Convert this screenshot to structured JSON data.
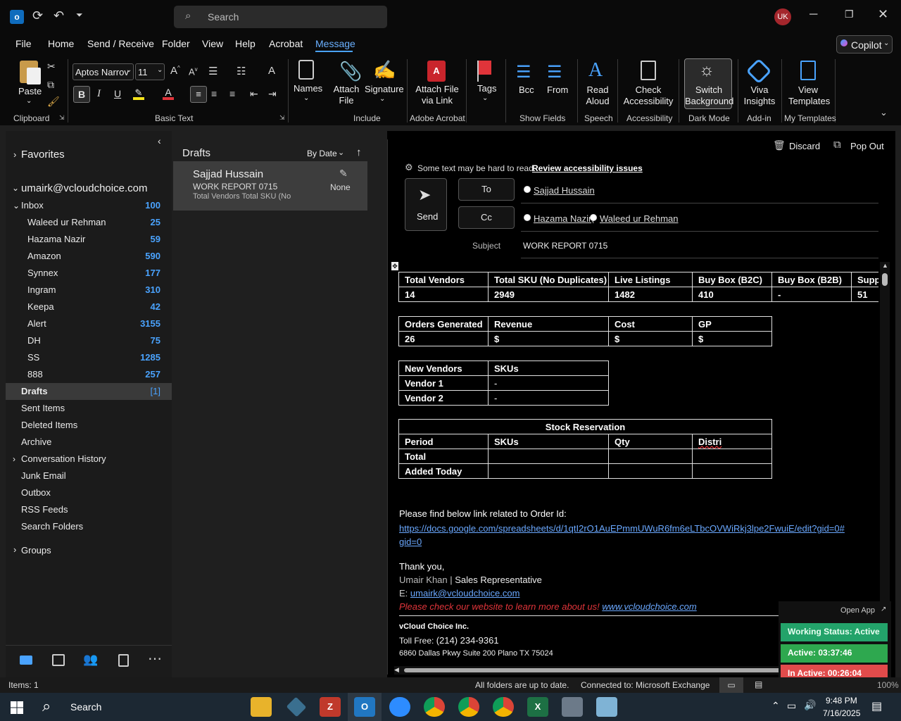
{
  "titlebar": {
    "search_placeholder": "Search",
    "avatar_initials": "UK"
  },
  "menu": [
    "File",
    "Home",
    "Send / Receive",
    "Folder",
    "View",
    "Help",
    "Acrobat",
    "Message"
  ],
  "active_menu": "Message",
  "copilot_label": "Copilot",
  "ribbon": {
    "paste": "Paste",
    "font_name": "Aptos Narrov",
    "font_size": "11",
    "names": "Names",
    "attach_file": [
      "Attach",
      "File"
    ],
    "signature": "Signature",
    "attach_via_link": [
      "Attach File",
      "via Link"
    ],
    "tags": "Tags",
    "bcc": "Bcc",
    "from": "From",
    "read_aloud": [
      "Read",
      "Aloud"
    ],
    "check_accessibility": [
      "Check",
      "Accessibility"
    ],
    "switch_background": [
      "Switch",
      "Background"
    ],
    "viva_insights": [
      "Viva",
      "Insights"
    ],
    "view_templates": [
      "View",
      "Templates"
    ],
    "groups": [
      "Clipboard",
      "Basic Text",
      "Include",
      "Adobe Acrobat",
      "Show Fields",
      "Speech",
      "Accessibility",
      "Dark Mode",
      "Add-in",
      "My Templates"
    ]
  },
  "nav": {
    "favorites": "Favorites",
    "account": "umairk@vcloudchoice.com",
    "folders": [
      {
        "name": "Inbox",
        "count": "100"
      },
      {
        "name": "Waleed ur Rehman",
        "count": "25"
      },
      {
        "name": "Hazama Nazir",
        "count": "59"
      },
      {
        "name": "Amazon",
        "count": "590"
      },
      {
        "name": "Synnex",
        "count": "177"
      },
      {
        "name": "Ingram",
        "count": "310"
      },
      {
        "name": "Keepa",
        "count": "42"
      },
      {
        "name": "Alert",
        "count": "3155"
      },
      {
        "name": "DH",
        "count": "75"
      },
      {
        "name": "SS",
        "count": "1285"
      },
      {
        "name": "888",
        "count": "257"
      },
      {
        "name": "Drafts",
        "count": "[1]"
      },
      {
        "name": "Sent Items",
        "count": ""
      },
      {
        "name": "Deleted Items",
        "count": ""
      },
      {
        "name": "Archive",
        "count": ""
      },
      {
        "name": "Conversation History",
        "count": ""
      },
      {
        "name": "Junk Email",
        "count": ""
      },
      {
        "name": "Outbox",
        "count": ""
      },
      {
        "name": "RSS Feeds",
        "count": ""
      },
      {
        "name": "Search Folders",
        "count": ""
      }
    ],
    "groups": "Groups"
  },
  "msglist": {
    "title": "Drafts",
    "sort": "By Date",
    "item": {
      "sender": "Sajjad Hussain",
      "subject": "WORK REPORT 0715",
      "preview": "Total Vendors  Total SKU (No",
      "tag": "None"
    }
  },
  "compose": {
    "discard": "Discard",
    "popout": "Pop Out",
    "accessibility_note": "Some text may be hard to read.",
    "accessibility_link": "Review accessibility issues",
    "send": "Send",
    "to_btn": "To",
    "cc_btn": "Cc",
    "to": [
      "Sajjad Hussain"
    ],
    "cc": [
      "Hazama Nazir;",
      "Waleed ur Rehman"
    ],
    "subject_label": "Subject",
    "subject": "WORK REPORT 0715"
  },
  "body": {
    "t1_head": [
      "Total Vendors",
      "Total SKU (No Duplicates)",
      "Live Listings",
      "Buy Box (B2C)",
      "Buy Box (B2B)",
      "Supp"
    ],
    "t1_row": [
      "14",
      "2949",
      "1482",
      "410",
      "-",
      "51"
    ],
    "t2_head": [
      "Orders Generated",
      "Revenue",
      "Cost",
      "GP"
    ],
    "t2_row": [
      "26",
      "$",
      "$",
      "$"
    ],
    "t3_head": [
      "New Vendors",
      "SKUs"
    ],
    "t3_rows": [
      [
        "Vendor 1",
        "-"
      ],
      [
        "Vendor 2",
        "-"
      ]
    ],
    "t4_title": "Stock Reservation",
    "t4_head": [
      "Period",
      "SKUs",
      "Qty",
      "Distri"
    ],
    "t4_rows": [
      "Total",
      "Added Today"
    ],
    "intro": "Please find below link related to Order Id:",
    "link": "https://docs.google.com/spreadsheets/d/1qtI2rO1AuEPmmUWuR6fm6eLTbcOVWiRkj3lpe2FwuiE/edit?gid=0#gid=0",
    "thanks": "Thank you,",
    "sig_name": "Umair Khan",
    "sig_title": "Sales Representative",
    "sig_email_label": "E:",
    "sig_email": "umairk@vcloudchoice.com",
    "sig_promo": "Please check our website to learn more about us!",
    "sig_site": "www.vcloudchoice.com",
    "company": "vCloud Choice Inc.",
    "tollfree_label": "Toll Free:",
    "tollfree": "(214) 234-9361",
    "address": "6860 Dallas Pkwy Suite 200 Plano TX 75024"
  },
  "widget": {
    "open_app": "Open App",
    "working_status": "Working Status: Active",
    "active": "Active: 03:37:46",
    "inactive": "In Active: 00:26:04"
  },
  "status": {
    "items": "Items: 1",
    "sync": "All folders are up to date.",
    "connected": "Connected to: Microsoft Exchange",
    "zoom": "100%"
  },
  "taskbar": {
    "search": "Search",
    "time": "9:48 PM",
    "date": "7/16/2025"
  },
  "colors": {
    "accent": "#4aa3ff",
    "link": "#6aa8ff",
    "promo_red": "#e0343a",
    "widget_green": "#2ea84f",
    "widget_red": "#e14b4b"
  }
}
